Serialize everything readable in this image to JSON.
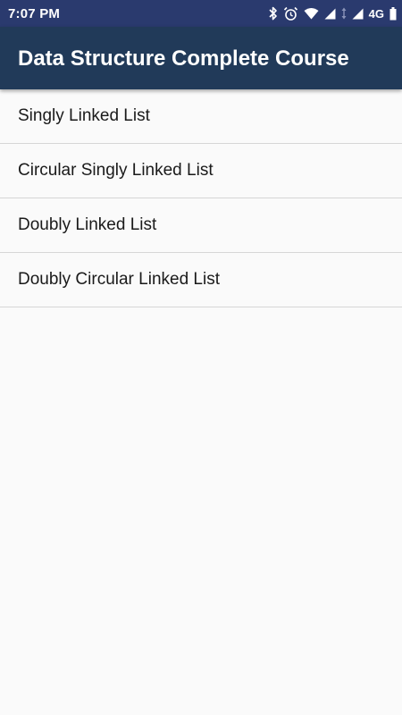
{
  "status_bar": {
    "time": "7:07 PM",
    "network": "4G",
    "icons": [
      "bluetooth-icon",
      "alarm-icon",
      "wifi-icon",
      "signal-icon",
      "data-activity-icon",
      "signal-icon",
      "battery-icon"
    ],
    "background_color": "#2a3a6e"
  },
  "app_bar": {
    "title": "Data Structure Complete Course",
    "background_color": "#213a59"
  },
  "list": {
    "items": [
      {
        "label": "Singly Linked List"
      },
      {
        "label": "Circular Singly Linked List"
      },
      {
        "label": "Doubly Linked List"
      },
      {
        "label": "Doubly Circular Linked List"
      }
    ]
  }
}
